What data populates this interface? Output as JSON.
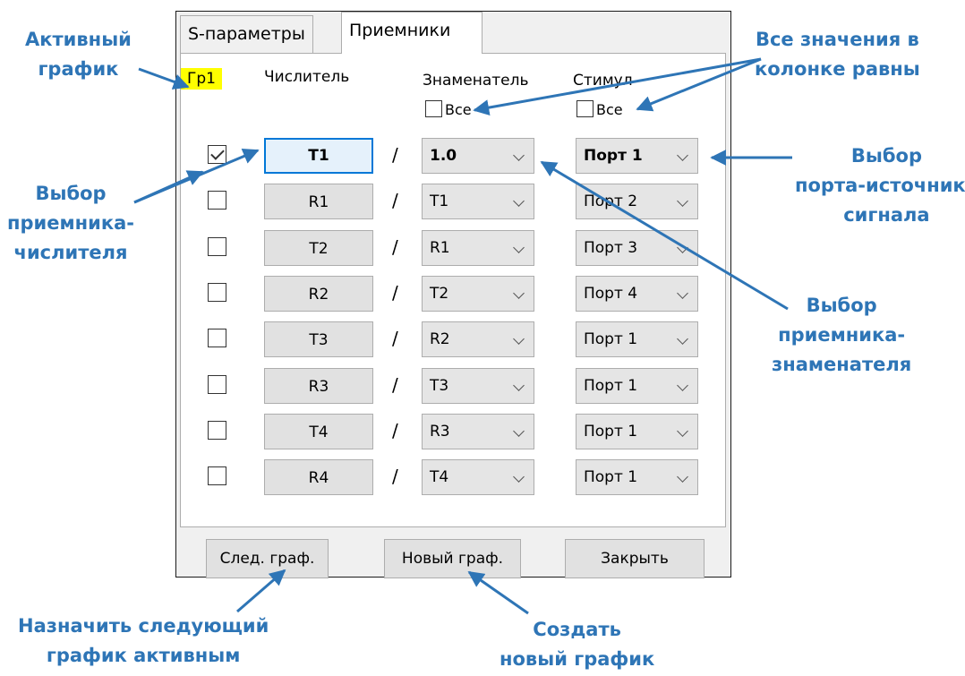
{
  "dialog": {
    "tabs": [
      {
        "label": "S-параметры",
        "active": false
      },
      {
        "label": "Приемники",
        "active": true
      }
    ],
    "headers": {
      "active_graph": "Гр1",
      "numerator": "Числитель",
      "denominator": "Знаменатель",
      "stimulus": "Стимул",
      "all_label": "Все"
    },
    "rows": [
      {
        "checked": true,
        "numerator": "T1",
        "denominator": "1.0",
        "stimulus": "Порт 1"
      },
      {
        "checked": false,
        "numerator": "R1",
        "denominator": "T1",
        "stimulus": "Порт 2"
      },
      {
        "checked": false,
        "numerator": "T2",
        "denominator": "R1",
        "stimulus": "Порт 3"
      },
      {
        "checked": false,
        "numerator": "R2",
        "denominator": "T2",
        "stimulus": "Порт 4"
      },
      {
        "checked": false,
        "numerator": "T3",
        "denominator": "R2",
        "stimulus": "Порт 1"
      },
      {
        "checked": false,
        "numerator": "R3",
        "denominator": "T3",
        "stimulus": "Порт 1"
      },
      {
        "checked": false,
        "numerator": "T4",
        "denominator": "R3",
        "stimulus": "Порт 1"
      },
      {
        "checked": false,
        "numerator": "R4",
        "denominator": "T4",
        "stimulus": "Порт 1"
      }
    ],
    "divider": "/",
    "buttons": {
      "next_graph": "След. граф.",
      "new_graph": "Новый граф.",
      "close": "Закрыть"
    }
  },
  "annotations": {
    "active_graph": [
      "Активный",
      "график"
    ],
    "all_equal": [
      "Все значения в",
      "колонке равны"
    ],
    "numerator_select": [
      "Выбор",
      "приемника-",
      "числителя"
    ],
    "source_port": [
      "Выбор",
      "порта-источника",
      "сигнала"
    ],
    "denominator_select": [
      "Выбор",
      "приемника-",
      "знаменателя"
    ],
    "next_active": [
      "Назначить следующий",
      "график активным"
    ],
    "create_new": [
      "Создать",
      "новый график"
    ]
  },
  "colors": {
    "annotation": "#2e75b6",
    "active_highlight": "#ffff00",
    "focus_border": "#0078d7"
  }
}
